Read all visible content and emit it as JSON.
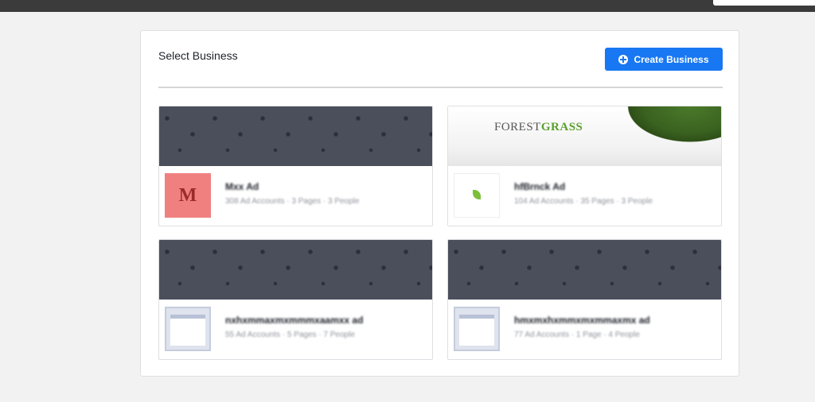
{
  "panel": {
    "title": "Select Business",
    "create_button_label": "Create Business"
  },
  "businesses": [
    {
      "name": "Mxx Ad",
      "meta": "308 Ad Accounts · 3 Pages · 3 People",
      "avatar": "M",
      "cover": "pattern"
    },
    {
      "name": "hfBrnck Ad",
      "meta": "104 Ad Accounts · 35 Pages · 3 People",
      "avatar": "logo",
      "cover": "grass",
      "cover_brand": [
        "FOREST",
        "GRASS"
      ]
    },
    {
      "name": "nxhxmmaxmxmmmxaamxx ad",
      "meta": "55 Ad Accounts · 5 Pages · 7 People",
      "avatar": "blank",
      "cover": "pattern"
    },
    {
      "name": "hmxmxhxmmxmxmmaxmx ad",
      "meta": "77 Ad Accounts · 1 Page · 4 People",
      "avatar": "blank",
      "cover": "pattern"
    }
  ],
  "colors": {
    "primary_button": "#1877f2",
    "cover_dark": "#4b4f5c",
    "avatar_red": "#f08080"
  }
}
